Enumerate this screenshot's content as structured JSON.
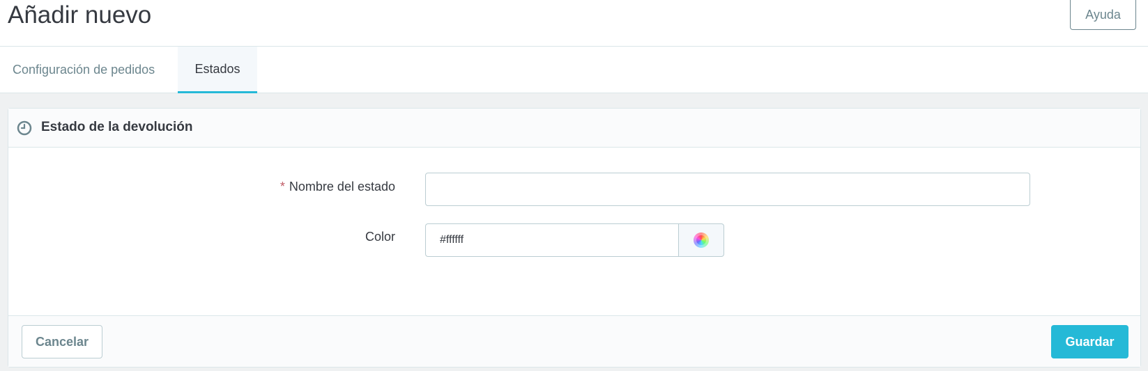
{
  "header": {
    "title": "Añadir nuevo",
    "help_label": "Ayuda"
  },
  "tabs": [
    {
      "label": "Configuración de pedidos",
      "active": false
    },
    {
      "label": "Estados",
      "active": true
    }
  ],
  "panel": {
    "icon": "clock-icon",
    "title": "Estado de la devolución",
    "fields": {
      "name": {
        "required_mark": "*",
        "label": "Nombre del estado",
        "value": "",
        "placeholder": ""
      },
      "color": {
        "label": "Color",
        "value": "#ffffff",
        "picker_icon": "color-wheel-icon"
      }
    },
    "footer": {
      "cancel_label": "Cancelar",
      "save_label": "Guardar"
    }
  },
  "colors": {
    "accent": "#25b9d7",
    "text": "#363a41",
    "muted": "#6c868e",
    "required": "#c05c67"
  }
}
